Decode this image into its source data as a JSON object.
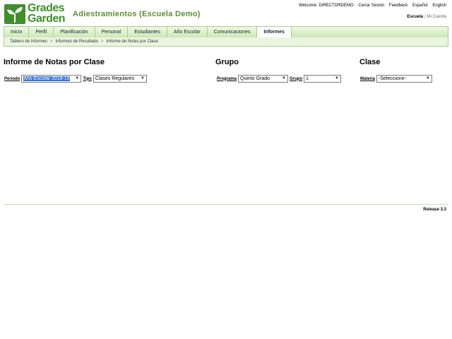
{
  "header": {
    "logo_line1": "Grades",
    "logo_line2": "Garden",
    "app_title": "Adiestramientos (Escuela Demo)",
    "welcome": "Welcome: DIRECTORDEMO",
    "logout": "Cerrar Sesión",
    "feedback": "Feedback",
    "lang_es": "Español",
    "lang_en": "English",
    "school_active": "Escuela",
    "school_sep": "|",
    "my_account": "Mi Cuenta"
  },
  "nav": {
    "tabs": [
      {
        "label": "Inicio"
      },
      {
        "label": "Perfil"
      },
      {
        "label": "Planificación"
      },
      {
        "label": "Personal"
      },
      {
        "label": "Estudiantes"
      },
      {
        "label": "Año Escolar"
      },
      {
        "label": "Comunicaciones"
      },
      {
        "label": "Informes"
      }
    ],
    "active_index": 7
  },
  "breadcrumb": [
    "Tablero de Informes",
    "Informes de Resultado",
    "Informe de Notas por Clase"
  ],
  "breadcrumb_sep": ">",
  "report": {
    "title": "Informe de Notas por Clase",
    "period_label": "Periodo",
    "period_value": "Año Escolar 2018-19",
    "type_label": "Tipo",
    "type_value": "Clases Regulares"
  },
  "group": {
    "title": "Grupo",
    "program_label": "Programa",
    "program_value": "Quinto Grado",
    "group_label": "Grupo",
    "group_value": "1"
  },
  "class": {
    "title": "Clase",
    "subject_label": "Materia",
    "subject_value": "-Seleccione-"
  },
  "footer": {
    "release": "Release 3.3"
  },
  "icons": {
    "dropdown": "chevron-down-icon",
    "logo": "sprout-logo-icon"
  },
  "colors": {
    "brand_green": "#3f8f2a",
    "nav_border": "#a8cf8a",
    "selection_blue": "#3875d7"
  }
}
